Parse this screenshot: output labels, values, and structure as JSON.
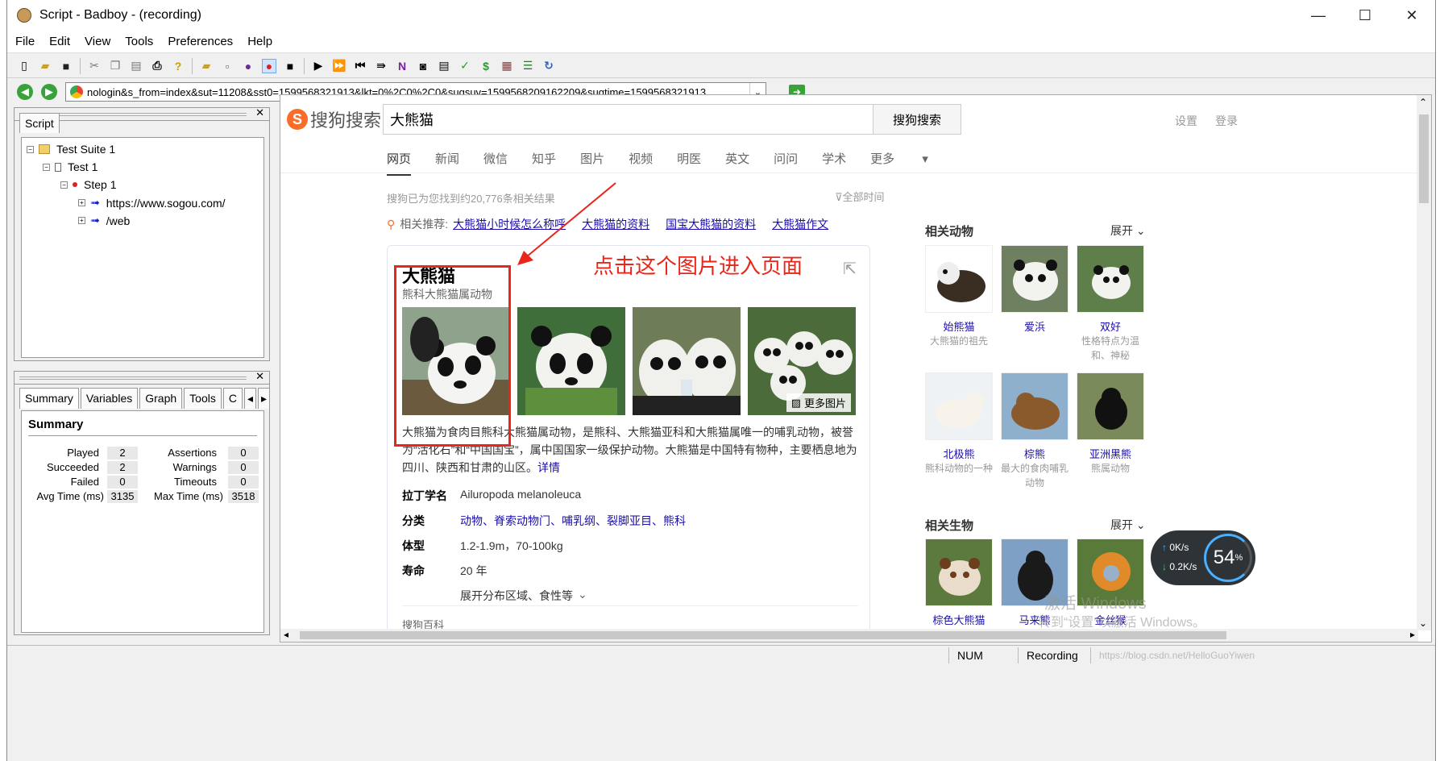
{
  "window": {
    "title": "Script - Badboy - (recording)",
    "minimize": "—",
    "maximize": "☐",
    "close": "✕"
  },
  "menu": [
    "File",
    "Edit",
    "View",
    "Tools",
    "Preferences",
    "Help"
  ],
  "address": {
    "url": "nologin&s_from=index&sut=11208&sst0=1599568321913&lkt=0%2C0%2C0&sugsuv=1599568209162209&sugtime=1599568321913"
  },
  "script_pane": {
    "tab": "Script",
    "tree": [
      {
        "label": "Test Suite 1"
      },
      {
        "label": "Test 1"
      },
      {
        "label": "Step 1"
      },
      {
        "label": "https://www.sogou.com/"
      },
      {
        "label": "/web"
      }
    ]
  },
  "summary_pane": {
    "tabs": [
      "Summary",
      "Variables",
      "Graph",
      "Tools",
      "C"
    ],
    "heading": "Summary",
    "left": [
      {
        "label": "Played",
        "value": "2"
      },
      {
        "label": "Succeeded",
        "value": "2"
      },
      {
        "label": "Failed",
        "value": "0"
      },
      {
        "label": "Avg Time (ms)",
        "value": "3135"
      }
    ],
    "right": [
      {
        "label": "Assertions",
        "value": "0"
      },
      {
        "label": "Warnings",
        "value": "0"
      },
      {
        "label": "Timeouts",
        "value": "0"
      },
      {
        "label": "Max Time (ms)",
        "value": "3518"
      }
    ]
  },
  "sogou": {
    "logo": "搜狗搜索",
    "query": "大熊猫",
    "search_btn": "搜狗搜索",
    "settings": "设置",
    "login": "登录",
    "tabs": [
      "网页",
      "新闻",
      "微信",
      "知乎",
      "图片",
      "视频",
      "明医",
      "英文",
      "问问",
      "学术",
      "更多"
    ],
    "result_count": "搜狗已为您找到约20,776条相关结果",
    "time_filter": "全部时间",
    "rec_label": "相关推荐:",
    "rec_links": [
      "大熊猫小时候怎么称呼",
      "大熊猫的资料",
      "国宝大熊猫的资料",
      "大熊猫作文"
    ],
    "card": {
      "title": "大熊猫",
      "subtitle": "熊科大熊猫属动物",
      "more_images": "更多图片",
      "desc": "大熊猫为食肉目熊科大熊猫属动物，是熊科、大熊猫亚科和大熊猫属唯一的哺乳动物，被誉为“活化石”和“中国国宝”，属中国国家一级保护动物。大熊猫是中国特有物种，主要栖息地为四川、陕西和甘肃的山区。",
      "desc_link": "详情",
      "latin_k": "拉丁学名",
      "latin_v": "Ailuropoda melanoleuca",
      "class_k": "分类",
      "class_v": "动物、脊索动物门、哺乳纲、裂脚亚目、熊科",
      "size_k": "体型",
      "size_v": "1.2-1.9m，70-100kg",
      "life_k": "寿命",
      "life_v": "20 年",
      "expand": "展开分布区域、食性等",
      "baike": "搜狗百科"
    },
    "annotation": "点击这个图片进入页面",
    "related_animals_title": "相关动物",
    "expand_label": "展开",
    "related_animals": [
      {
        "name": "始熊猫",
        "desc": "大熊猫的祖先"
      },
      {
        "name": "爱浜",
        "desc": ""
      },
      {
        "name": "双好",
        "desc": "性格特点为温和、神秘"
      },
      {
        "name": "北极熊",
        "desc": "熊科动物的一种"
      },
      {
        "name": "棕熊",
        "desc": "最大的食肉哺乳动物"
      },
      {
        "name": "亚洲黑熊",
        "desc": "熊属动物"
      }
    ],
    "related_bio_title": "相关生物",
    "related_bio": [
      {
        "name": "棕色大熊猫"
      },
      {
        "name": "马来熊"
      },
      {
        "name": "金丝猴"
      }
    ],
    "net_up": "0K/s",
    "net_down": "0.2K/s",
    "net_pct": "54",
    "watermark1": "激活 Windows",
    "watermark2": "转到“设置”以激活 Windows。"
  },
  "status": {
    "num": "NUM",
    "state": "Recording",
    "blog": "https://blog.csdn.net/HelloGuoYiwen"
  }
}
